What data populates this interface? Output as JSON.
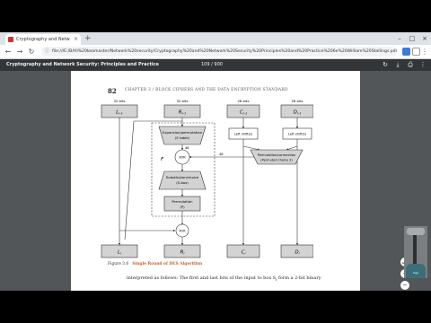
{
  "browser": {
    "tab_title": "Cryptography and Netw",
    "tab_close": "×",
    "new_tab": "+",
    "window_controls": [
      "–",
      "□",
      "×"
    ],
    "nav_buttons": [
      "←",
      "→",
      "↻"
    ],
    "url": "file:///E:/B/HI%20keamaster/Network%20security/Cryptography%20and%20Network%20Security%20Principles%20and%20Practice%206e%20William%20Stallings.pdf",
    "bookmark_icon": "star-icon"
  },
  "pdf_toolbar": {
    "doc_title": "Cryptography and Network Security: Principles and Practice",
    "page_indicator": "109 / 900",
    "icons": [
      "rotate-icon",
      "download-icon",
      "print-icon",
      "more-icon"
    ]
  },
  "page": {
    "page_number": "82",
    "chapter_heading": "CHAPTER 3 / BLOCK CIPHERS AND THE DATA ENCRYPTION STANDARD",
    "figure_label": "Figure 3.6",
    "figure_title": "Single Round of DES Algorithm",
    "body_line": "interpreted as follows: The first and last bits of the input to box S",
    "body_sub": "i",
    "body_rest": " form a 2-bit binary"
  },
  "diagram": {
    "bits_32": "32 bits",
    "bits_28": "28 bits",
    "bits_48": "48",
    "L_prev": "L",
    "R_prev": "R",
    "C_prev": "C",
    "D_prev": "D",
    "sub_prev": "i–1",
    "sub_cur": "i",
    "expansion": [
      "Expansion/permutation",
      "(E table)"
    ],
    "xor": "XOR",
    "F": "F",
    "K": "K",
    "substitution": [
      "Substitution/choice",
      "(S-box)"
    ],
    "permutation": [
      "Permutation",
      "(P)"
    ],
    "shift_left": "Left shift(s)",
    "shift_right": "Left shift(s)",
    "pc2": [
      "Permutation/contraction",
      "(Permuted choice 2)"
    ],
    "L_out": "L",
    "R_out": "R",
    "C_out": "C",
    "D_out": "D"
  },
  "viewer_tools": [
    "fit-page-icon",
    "zoom-in-icon",
    "zoom-out-icon"
  ],
  "webcam": {
    "caption": "logo"
  },
  "colors": {
    "toolbar": "#323639",
    "viewer_bg": "#525659",
    "diagram_fill": "#d3d3d3",
    "accent": "#c0622b"
  }
}
